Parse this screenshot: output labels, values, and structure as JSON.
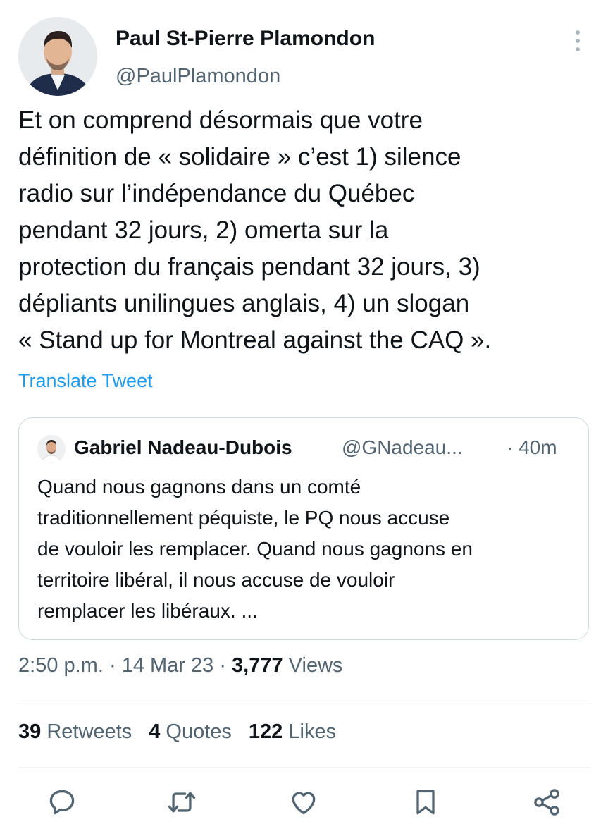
{
  "author": {
    "name": "Paul St-Pierre Plamondon",
    "handle": "@PaulPlamondon"
  },
  "tweet": {
    "text": "Et on comprend désormais que votre\ndéfinition de « solidaire » c’est 1) silence\nradio sur l’indépendance du Québec\npendant 32 jours, 2) omerta sur la\nprotection du français pendant 32 jours, 3)\ndépliants unilingues anglais, 4) un slogan\n« Stand up for Montreal against the CAQ ».",
    "translate_label": "Translate Tweet"
  },
  "quoted": {
    "name": "Gabriel Nadeau-Dubois",
    "handle": "@GNadeau...",
    "time": "· 40m",
    "text": "Quand nous gagnons dans un comté\ntraditionnellement péquiste, le PQ nous accuse\nde vouloir les remplacer. Quand nous gagnons en\nterritoire libéral, il nous accuse de vouloir\nremplacer les libéraux. ..."
  },
  "meta": {
    "time": "2:50 p.m.",
    "sep1": " · ",
    "date": "14 Mar 23",
    "sep2": " · ",
    "views_count": "3,777",
    "views_label": " Views"
  },
  "stats": {
    "retweets_count": "39",
    "retweets_label": "Retweets",
    "quotes_count": "4",
    "quotes_label": "Quotes",
    "likes_count": "122",
    "likes_label": "Likes"
  },
  "actions": [
    "reply-icon",
    "retweet-icon",
    "like-icon",
    "bookmark-icon",
    "share-icon"
  ],
  "colors": {
    "text": "#0f1419",
    "secondary": "#536471",
    "link": "#1d9bf0",
    "border": "#cfd9de"
  }
}
